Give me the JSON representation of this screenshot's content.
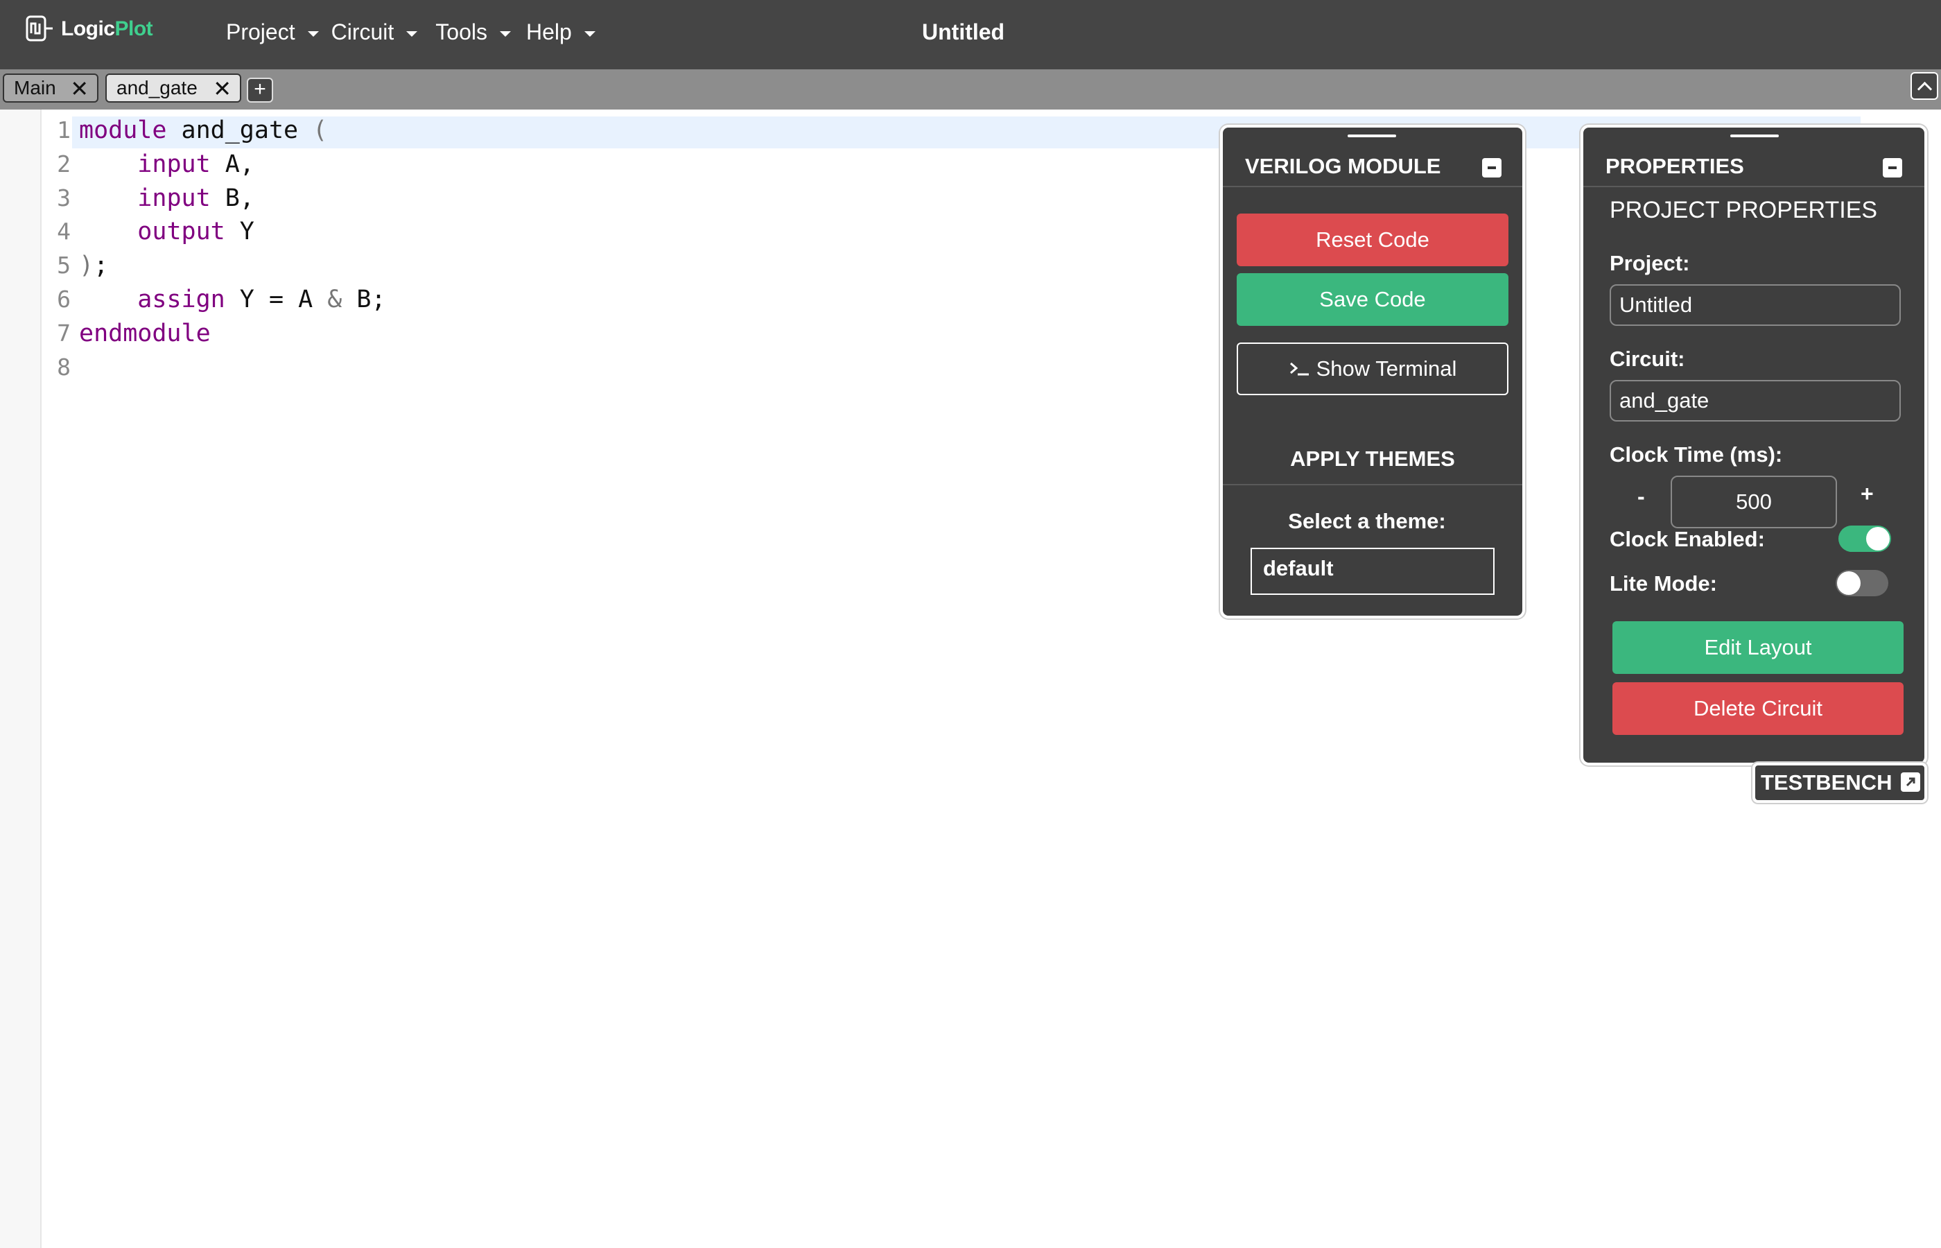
{
  "app": {
    "logo_word1": "Logic",
    "logo_word2": "Plot",
    "document_title": "Untitled"
  },
  "menu": [
    {
      "label": "Project"
    },
    {
      "label": "Circuit"
    },
    {
      "label": "Tools"
    },
    {
      "label": "Help"
    }
  ],
  "tabs": [
    {
      "label": "Main",
      "close": "✕"
    },
    {
      "label": "and_gate",
      "close": "✕"
    }
  ],
  "tab_add_label": "+",
  "editor": {
    "lines": [
      {
        "num": "1",
        "tokens": [
          {
            "t": "module",
            "k": "kw"
          },
          {
            "t": " and_gate ",
            "k": ""
          },
          {
            "t": "(",
            "k": "punc"
          }
        ]
      },
      {
        "num": "2",
        "tokens": [
          {
            "t": "    ",
            "k": ""
          },
          {
            "t": "input",
            "k": "kw"
          },
          {
            "t": " A,",
            "k": ""
          }
        ]
      },
      {
        "num": "3",
        "tokens": [
          {
            "t": "    ",
            "k": ""
          },
          {
            "t": "input",
            "k": "kw"
          },
          {
            "t": " B,",
            "k": ""
          }
        ]
      },
      {
        "num": "4",
        "tokens": [
          {
            "t": "    ",
            "k": ""
          },
          {
            "t": "output",
            "k": "kw"
          },
          {
            "t": " Y",
            "k": ""
          }
        ]
      },
      {
        "num": "5",
        "tokens": [
          {
            "t": ")",
            "k": "punc"
          },
          {
            "t": ";",
            "k": ""
          }
        ]
      },
      {
        "num": "6",
        "tokens": [
          {
            "t": "    ",
            "k": ""
          },
          {
            "t": "assign",
            "k": "kw"
          },
          {
            "t": " Y = A ",
            "k": ""
          },
          {
            "t": "&",
            "k": "punc"
          },
          {
            "t": " B;",
            "k": ""
          }
        ]
      },
      {
        "num": "7",
        "tokens": [
          {
            "t": "endmodule",
            "k": "kw"
          }
        ]
      },
      {
        "num": "8",
        "tokens": []
      }
    ]
  },
  "verilog_panel": {
    "title": "VERILOG MODULE",
    "reset_label": "Reset Code",
    "save_label": "Save Code",
    "terminal_icon": "terminal-icon",
    "terminal_label": "Show Terminal",
    "themes_heading": "APPLY THEMES",
    "select_label": "Select a theme:",
    "selected_theme": "default"
  },
  "properties_panel": {
    "title": "PROPERTIES",
    "subheading": "PROJECT PROPERTIES",
    "project_label": "Project:",
    "project_value": "Untitled",
    "circuit_label": "Circuit:",
    "circuit_value": "and_gate",
    "clock_label": "Clock Time (ms):",
    "clock_minus": "-",
    "clock_value": "500",
    "clock_plus": "+",
    "clock_enabled_label": "Clock Enabled:",
    "clock_enabled": true,
    "lite_mode_label": "Lite Mode:",
    "lite_mode": false,
    "edit_layout_label": "Edit Layout",
    "delete_circuit_label": "Delete Circuit"
  },
  "testbench": {
    "label": "TESTBENCH",
    "icon": "external-link-icon"
  },
  "colors": {
    "topbar": "#454545",
    "accent_green": "#3bb77e",
    "danger_red": "#dc4b4f",
    "keyword": "#800080"
  }
}
